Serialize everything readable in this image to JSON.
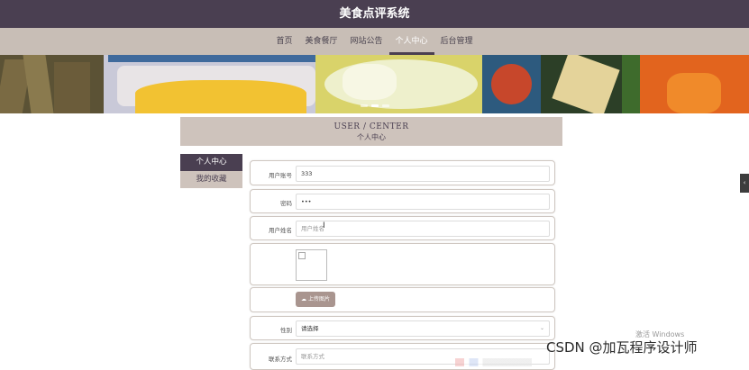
{
  "header": {
    "title": "美食点评系统"
  },
  "nav": {
    "items": [
      {
        "label": "首页"
      },
      {
        "label": "美食餐厅"
      },
      {
        "label": "网站公告"
      },
      {
        "label": "个人中心"
      },
      {
        "label": "后台管理"
      }
    ],
    "active": "个人中心"
  },
  "banner": {
    "slides": 3,
    "active_slide": 2
  },
  "section": {
    "title_en": "USER / CENTER",
    "title_cn": "个人中心"
  },
  "sidebar": {
    "items": [
      {
        "label": "个人中心"
      },
      {
        "label": "我的收藏"
      }
    ]
  },
  "form": {
    "account": {
      "label": "用户账号",
      "value": "333"
    },
    "password": {
      "label": "密码",
      "value": "•••"
    },
    "name": {
      "label": "用户姓名",
      "placeholder": "用户姓名"
    },
    "upload_label": "上传图片",
    "gender": {
      "label": "性别",
      "selected": "请选择"
    },
    "contact": {
      "label": "联系方式",
      "placeholder": "联系方式"
    }
  },
  "overlay": {
    "activation": "激活 Windows",
    "watermark": "CSDN @加瓦程序设计师",
    "handle": "‹"
  }
}
